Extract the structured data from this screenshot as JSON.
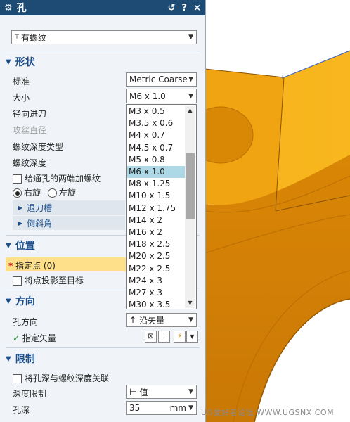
{
  "dialog": {
    "title": "孔",
    "title_icon": "gear-icon",
    "buttons": {
      "reset": "↺",
      "help": "?",
      "close": "×"
    }
  },
  "type": {
    "value": "有螺纹",
    "icon": "thread-hole-icon"
  },
  "shape": {
    "header": "形状",
    "standard_label": "标准",
    "standard_value": "Metric Coarse",
    "size_label": "大小",
    "size_value": "M6 x 1.0",
    "radial_feed_label": "径向进刀",
    "tap_drill_label": "攻丝直径",
    "thread_depth_type_label": "螺纹深度类型",
    "thread_depth_label": "螺纹深度",
    "thread_both_ends_label": "给通孔的两端加螺纹",
    "right_hand_label": "右旋",
    "left_hand_label": "左旋",
    "relief_label": "退刀槽",
    "chamfer_label": "倒斜角"
  },
  "size_options": [
    "M3 x 0.5",
    "M3.5 x 0.6",
    "M4 x 0.7",
    "M4.5 x 0.7",
    "M5 x 0.8",
    "M6 x 1.0",
    "M8 x 1.25",
    "M10 x 1.5",
    "M12 x 1.75",
    "M14 x 2",
    "M16 x 2",
    "M18 x 2.5",
    "M20 x 2.5",
    "M22 x 2.5",
    "M24 x 3",
    "M27 x 3",
    "M30 x 3.5"
  ],
  "position": {
    "header": "位置",
    "specify_point_label": "指定点 (0)",
    "project_point_label": "将点投影至目标"
  },
  "direction": {
    "header": "方向",
    "hole_direction_label": "孔方向",
    "hole_direction_value": "沿矢量",
    "specify_vector_label": "指定矢量"
  },
  "limit": {
    "header": "限制",
    "associate_label": "将孔深与螺纹深度关联",
    "depth_limit_label": "深度限制",
    "depth_limit_value": "值",
    "hole_depth_label": "孔深",
    "hole_depth_value": "35",
    "hole_depth_unit": "mm"
  },
  "watermark": "UG爱好者论坛 WWW.UGSNX.COM",
  "colors": {
    "title_bar": "#1e4b73",
    "section_header": "#1b4e8a",
    "selection": "#add8e6",
    "required_highlight": "#ffe08a",
    "model": "#f2a20c"
  }
}
